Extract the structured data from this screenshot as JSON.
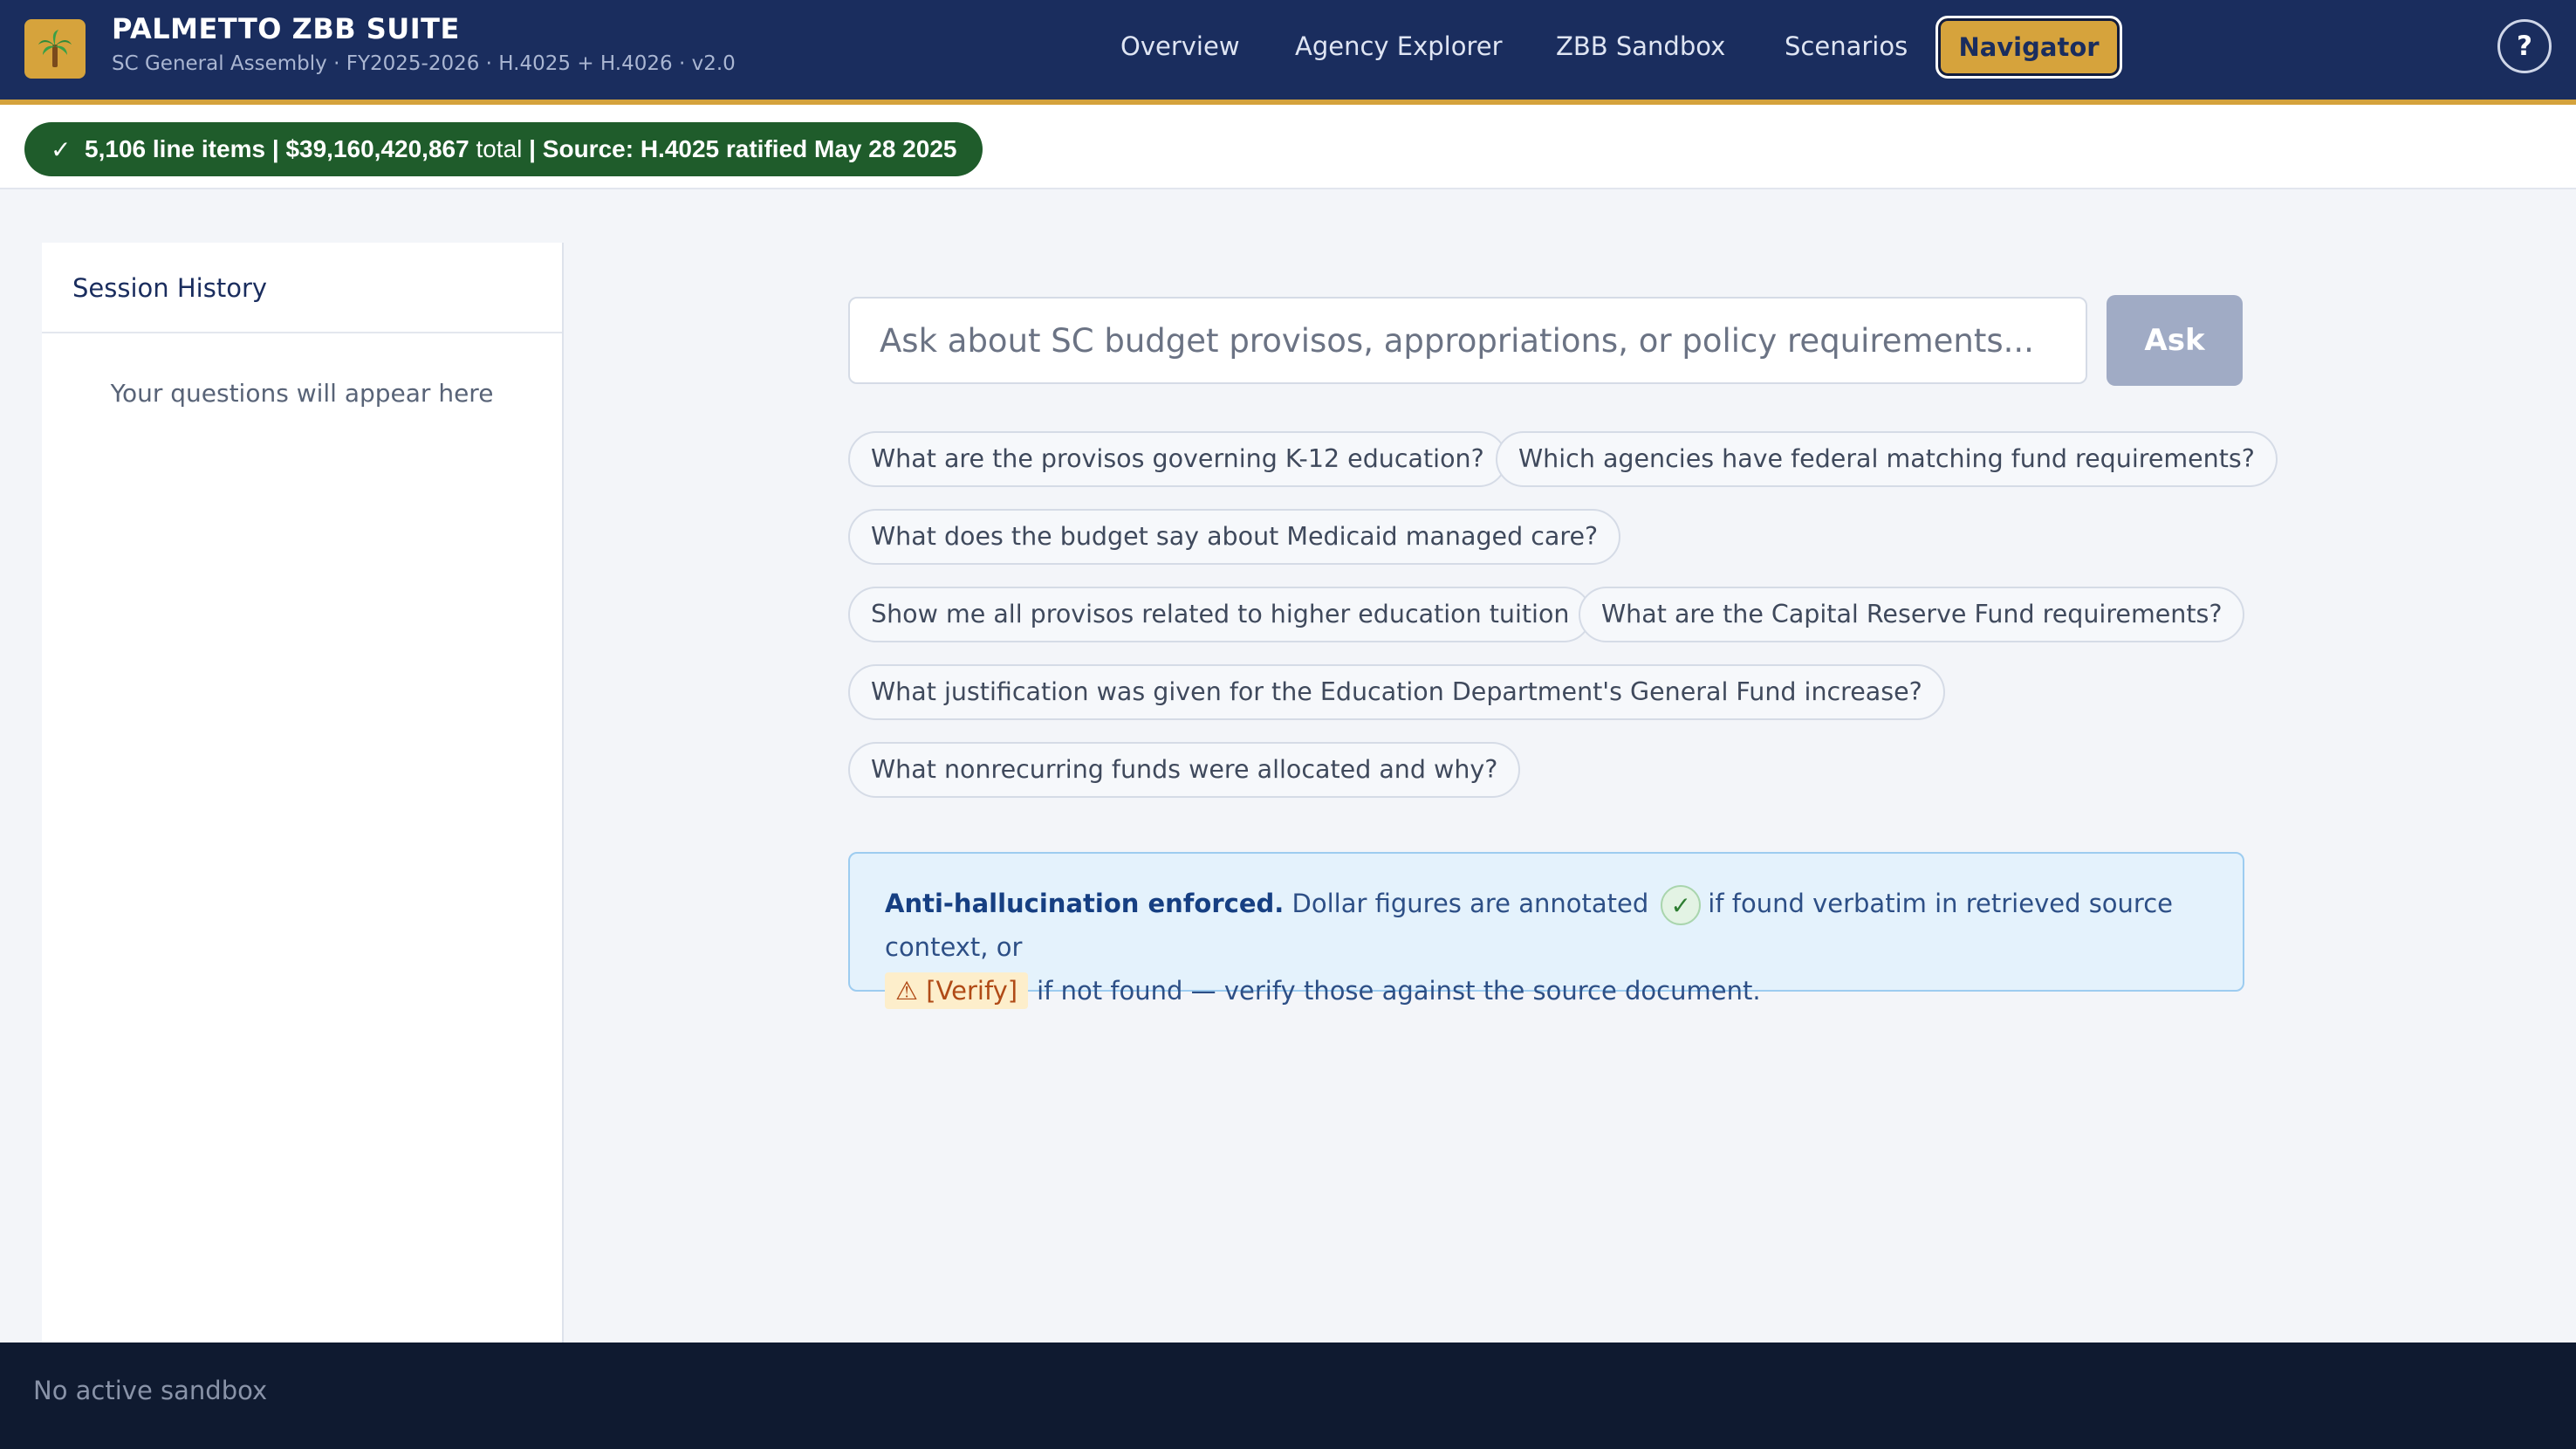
{
  "header": {
    "title": "PALMETTO ZBB SUITE",
    "subtitle": "SC General Assembly · FY2025-2026 · H.4025 + H.4026 · v2.0",
    "logo_icon": "palm-tree-icon",
    "nav": [
      {
        "label": "Overview"
      },
      {
        "label": "Agency Explorer"
      },
      {
        "label": "ZBB Sandbox"
      },
      {
        "label": "Scenarios"
      },
      {
        "label": "Navigator"
      }
    ],
    "help_label": "?"
  },
  "status": {
    "check": "✓",
    "line_items": "5,106 line items",
    "sep1": "|",
    "total_amount": "$39,160,420,867",
    "total_label": "total",
    "sep2": "|",
    "source": "Source: H.4025 ratified May 28 2025",
    "bg_color": "#1f5c2b"
  },
  "sidebar": {
    "title": "Session History",
    "empty_text": "Your questions will appear here"
  },
  "main": {
    "search": {
      "placeholder": "Ask about SC budget provisos, appropriations, or policy requirements...",
      "value": ""
    },
    "ask_label": "Ask",
    "suggestions": [
      "What are the provisos governing K-12 education?",
      "Which agencies have federal matching fund requirements?",
      "What does the budget say about Medicaid managed care?",
      "Show me all provisos related to higher education tuition",
      "What are the Capital Reserve Fund requirements?",
      "What justification was given for the Education Department's General Fund increase?",
      "What nonrecurring funds were allocated and why?"
    ],
    "notice": {
      "strong": "Anti-hallucination enforced.",
      "text1": "Dollar figures are annotated",
      "check": "✓",
      "text2": "if found verbatim in retrieved source context, or",
      "verify_badge": "⚠ [Verify]",
      "text3": "if not found — verify those against the source document."
    }
  },
  "footer": {
    "text": "No active sandbox"
  },
  "colors": {
    "header_bg": "#1a2d5e",
    "accent": "#d6a33c",
    "footer_bg": "#0f1a30"
  }
}
